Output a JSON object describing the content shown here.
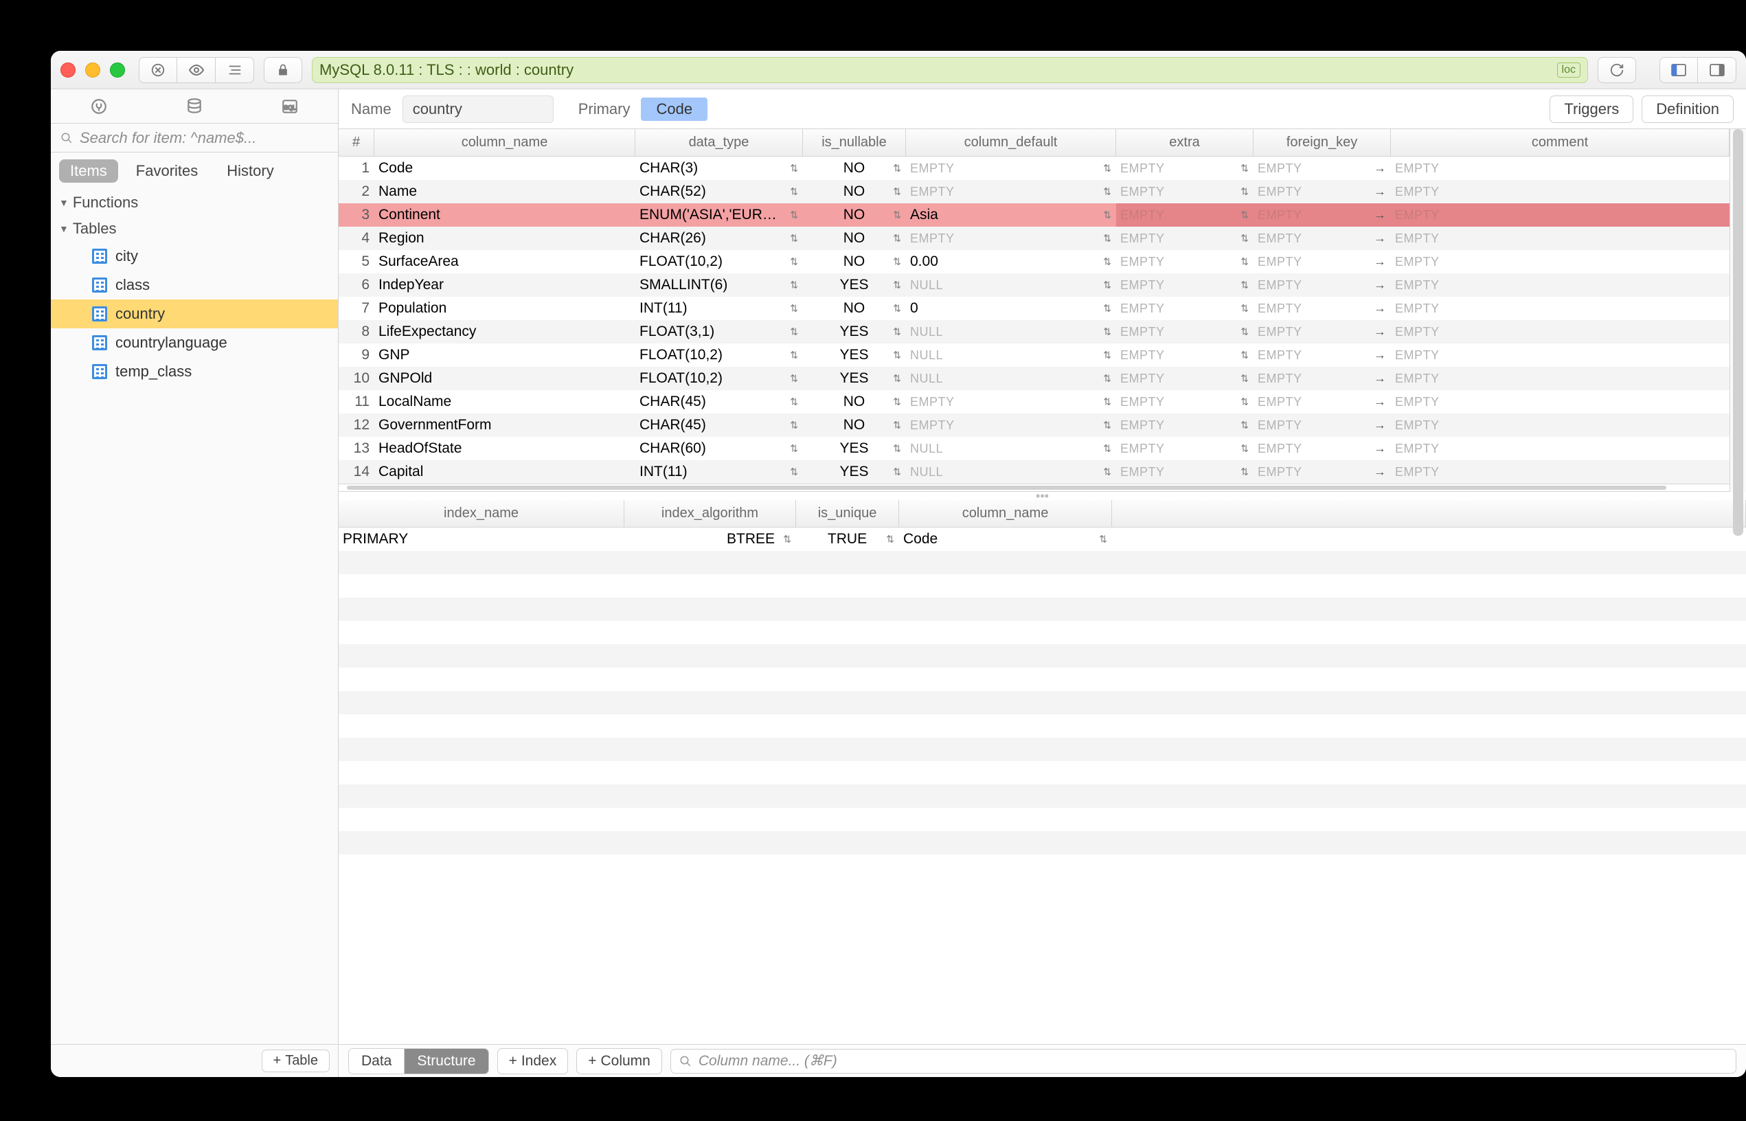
{
  "window": {
    "address": "MySQL 8.0.11 : TLS :  : world : country",
    "loc_tag": "loc"
  },
  "sidebar": {
    "search_placeholder": "Search for item: ^name$...",
    "tabs": {
      "items": "Items",
      "favorites": "Favorites",
      "history": "History"
    },
    "sections": {
      "functions": "Functions",
      "tables": "Tables"
    },
    "tables": [
      {
        "label": "city"
      },
      {
        "label": "class"
      },
      {
        "label": "country",
        "selected": true
      },
      {
        "label": "countrylanguage"
      },
      {
        "label": "temp_class"
      }
    ],
    "add_table": "Table"
  },
  "header": {
    "name_label": "Name",
    "name_value": "country",
    "primary_label": "Primary",
    "primary_value": "Code",
    "triggers": "Triggers",
    "definition": "Definition"
  },
  "columns": {
    "headers": {
      "idx": "#",
      "name": "column_name",
      "type": "data_type",
      "nullable": "is_nullable",
      "def": "column_default",
      "extra": "extra",
      "fk": "foreign_key",
      "comment": "comment"
    },
    "empty_ph": "EMPTY",
    "rows": [
      {
        "idx": "1",
        "name": "Code",
        "type": "CHAR(3)",
        "nullable": "NO",
        "def": "",
        "def_ph": true
      },
      {
        "idx": "2",
        "name": "Name",
        "type": "CHAR(52)",
        "nullable": "NO",
        "def": "",
        "def_ph": true
      },
      {
        "idx": "3",
        "name": "Continent",
        "type": "ENUM('ASIA','EUR…",
        "nullable": "NO",
        "def": "Asia",
        "def_ph": false,
        "hl": true
      },
      {
        "idx": "4",
        "name": "Region",
        "type": "CHAR(26)",
        "nullable": "NO",
        "def": "",
        "def_ph": true
      },
      {
        "idx": "5",
        "name": "SurfaceArea",
        "type": "FLOAT(10,2)",
        "nullable": "NO",
        "def": "0.00",
        "def_ph": false
      },
      {
        "idx": "6",
        "name": "IndepYear",
        "type": "SMALLINT(6)",
        "nullable": "YES",
        "def": "NULL",
        "def_ph": true
      },
      {
        "idx": "7",
        "name": "Population",
        "type": "INT(11)",
        "nullable": "NO",
        "def": "0",
        "def_ph": false
      },
      {
        "idx": "8",
        "name": "LifeExpectancy",
        "type": "FLOAT(3,1)",
        "nullable": "YES",
        "def": "NULL",
        "def_ph": true
      },
      {
        "idx": "9",
        "name": "GNP",
        "type": "FLOAT(10,2)",
        "nullable": "YES",
        "def": "NULL",
        "def_ph": true
      },
      {
        "idx": "10",
        "name": "GNPOld",
        "type": "FLOAT(10,2)",
        "nullable": "YES",
        "def": "NULL",
        "def_ph": true
      },
      {
        "idx": "11",
        "name": "LocalName",
        "type": "CHAR(45)",
        "nullable": "NO",
        "def": "",
        "def_ph": true
      },
      {
        "idx": "12",
        "name": "GovernmentForm",
        "type": "CHAR(45)",
        "nullable": "NO",
        "def": "",
        "def_ph": true
      },
      {
        "idx": "13",
        "name": "HeadOfState",
        "type": "CHAR(60)",
        "nullable": "YES",
        "def": "NULL",
        "def_ph": true
      },
      {
        "idx": "14",
        "name": "Capital",
        "type": "INT(11)",
        "nullable": "YES",
        "def": "NULL",
        "def_ph": true
      }
    ]
  },
  "indexes": {
    "headers": {
      "name": "index_name",
      "alg": "index_algorithm",
      "unique": "is_unique",
      "col": "column_name"
    },
    "rows": [
      {
        "name": "PRIMARY",
        "alg": "BTREE",
        "unique": "TRUE",
        "col": "Code"
      }
    ]
  },
  "footer": {
    "data": "Data",
    "structure": "Structure",
    "add_index": "Index",
    "add_column": "Column",
    "search_placeholder": "Column name... (⌘F)"
  }
}
